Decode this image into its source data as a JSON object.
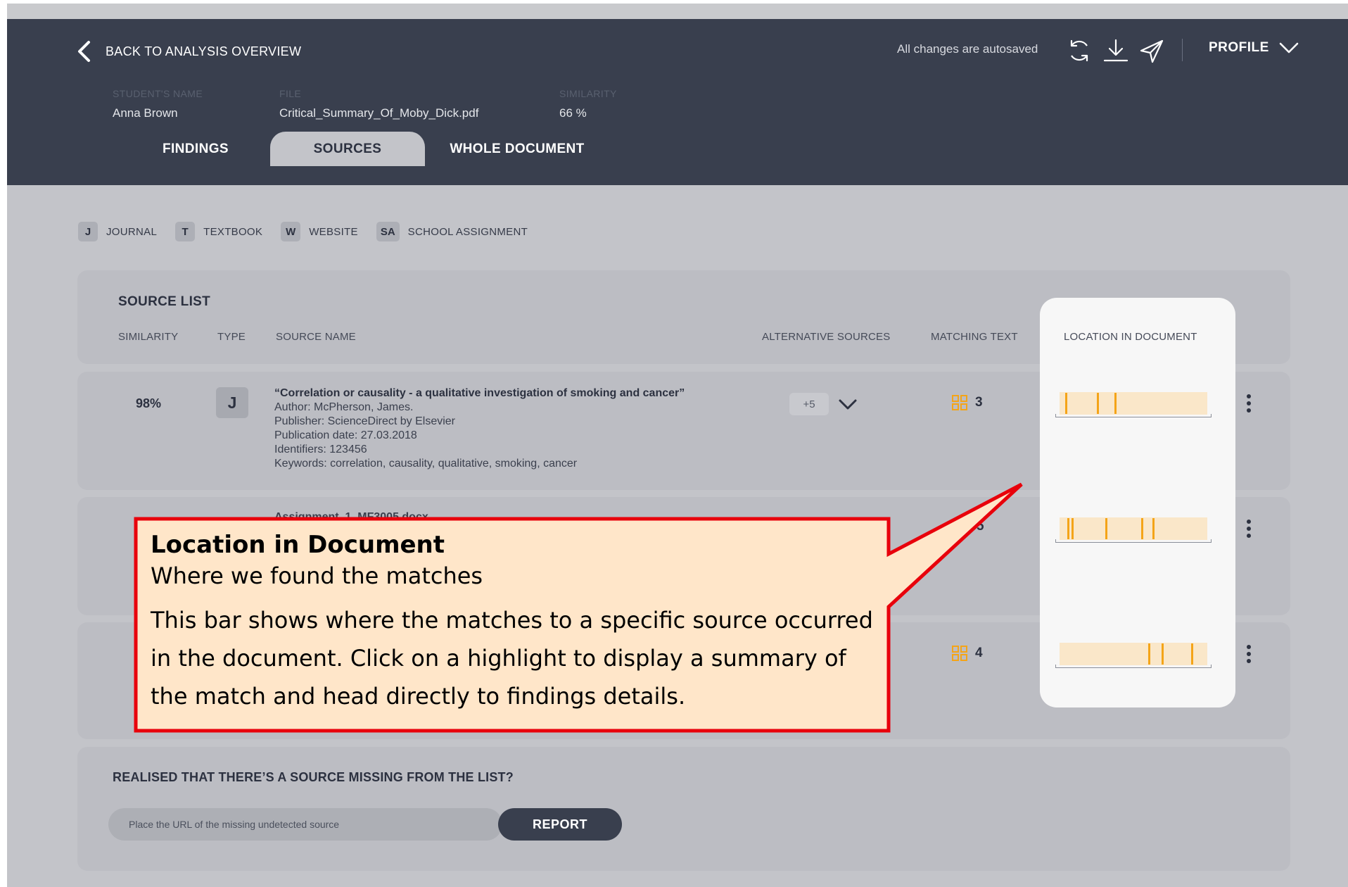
{
  "header": {
    "back_label": "BACK TO ANALYSIS OVERVIEW",
    "autosave_text": "All changes are autosaved",
    "profile_label": "PROFILE",
    "icons": [
      "refresh-icon",
      "download-icon",
      "send-icon",
      "chevron-down-icon"
    ],
    "colors": {
      "header_bg": "#393f4e",
      "accent": "#f4a418"
    }
  },
  "meta": {
    "student_label": "STUDENT'S NAME",
    "student_value": "Anna Brown",
    "file_label": "FILE",
    "file_value": "Critical_Summary_Of_Moby_Dick.pdf",
    "similarity_label": "SIMILARITY",
    "similarity_value": "66 %"
  },
  "tabs": [
    {
      "label": "FINDINGS",
      "active": false
    },
    {
      "label": "SOURCES",
      "active": true
    },
    {
      "label": "WHOLE DOCUMENT",
      "active": false
    }
  ],
  "legend": [
    {
      "code": "J",
      "label": "JOURNAL"
    },
    {
      "code": "T",
      "label": "TEXTBOOK"
    },
    {
      "code": "W",
      "label": "WEBSITE"
    },
    {
      "code": "SA",
      "label": "SCHOOL ASSIGNMENT"
    }
  ],
  "source_list": {
    "title": "SOURCE LIST",
    "columns": {
      "similarity": "SIMILARITY",
      "type": "TYPE",
      "source_name": "SOURCE NAME",
      "alternative": "ALTERNATIVE SOURCES",
      "matching": "MATCHING TEXT",
      "location": "LOCATION IN DOCUMENT"
    },
    "rows": [
      {
        "similarity": "98%",
        "type": "J",
        "title": "“Correlation or causality - a qualitative investigation of smoking and cancer”",
        "author": "Author: McPherson, James.",
        "publisher": "Publisher: ScienceDirect by Elsevier",
        "date": "Publication date: 27.03.2018",
        "identifiers": "Identifiers: 123456",
        "keywords": "Keywords: correlation, causality, qualitative, smoking, cancer",
        "alternative_count": "+5",
        "matching_count": "3",
        "location_marks": [
          0.04,
          0.25,
          0.37
        ]
      },
      {
        "title_partial": "Assignment_1_MF3005.docx",
        "matching_count": "5",
        "location_marks": [
          0.05,
          0.08,
          0.31,
          0.55,
          0.63
        ]
      },
      {
        "matching_count": "4",
        "location_marks": [
          0.6,
          0.69,
          0.89
        ]
      }
    ]
  },
  "missing": {
    "title": "REALISED THAT THERE’S A SOURCE MISSING FROM THE LIST?",
    "placeholder": "Place the URL of the missing undetected source",
    "button": "REPORT"
  },
  "callout": {
    "title": "Location in Document",
    "subtitle": "Where we found the matches",
    "body": "This bar shows where the matches to a specific source occurred in the document. Click on a highlight to display a summary of the match and head directly to findings details."
  }
}
